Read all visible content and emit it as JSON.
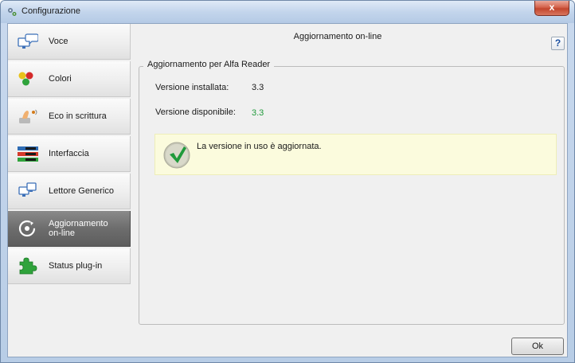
{
  "window": {
    "title": "Configurazione",
    "close_label": "x",
    "icon": "app-settings-icon"
  },
  "sidebar": {
    "items": [
      {
        "label": "Voce",
        "icon": "monitor-speech-icon",
        "active": false
      },
      {
        "label": "Colori",
        "icon": "color-dots-icon",
        "active": false
      },
      {
        "label": "Eco in scrittura",
        "icon": "hand-typing-icon",
        "active": false
      },
      {
        "label": "Interfaccia",
        "icon": "interface-bars-icon",
        "active": false
      },
      {
        "label": "Lettore Generico",
        "icon": "generic-reader-icon",
        "active": false
      },
      {
        "label": "Aggiornamento on-line",
        "icon": "update-refresh-icon",
        "active": true
      },
      {
        "label": "Status plug-in",
        "icon": "puzzle-piece-icon",
        "active": false
      }
    ]
  },
  "main": {
    "title": "Aggiornamento on-line",
    "help_label": "?",
    "group_title": "Aggiornamento per Alfa Reader",
    "installed_label": "Versione installata:",
    "installed_value": "3.3",
    "available_label": "Versione disponibile:",
    "available_value": "3.3",
    "status_message": "La versione in uso è aggiornata.",
    "ok_label": "Ok"
  },
  "colors": {
    "accent_green": "#1f9a3a",
    "info_background": "#fbfbdd",
    "active_nav": "#6d6d6d"
  }
}
